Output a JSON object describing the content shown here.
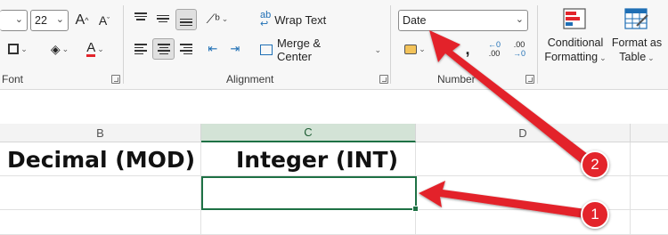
{
  "ribbon": {
    "font": {
      "size_value": "22",
      "grow_label": "A",
      "shrink_label": "A",
      "group_label": "Font"
    },
    "alignment": {
      "wrap_text_label": "Wrap Text",
      "merge_center_label": "Merge & Center",
      "group_label": "Alignment"
    },
    "number": {
      "format_value": "Date",
      "group_label": "Number",
      "increase_decimal_top": "←0",
      "increase_decimal_bottom": ".00",
      "decrease_decimal_top": ".00",
      "decrease_decimal_bottom": "→0"
    },
    "styles": {
      "conditional_line1": "Conditional",
      "conditional_line2": "Formatting",
      "format_table_line1": "Format as",
      "format_table_line2": "Table"
    }
  },
  "sheet": {
    "columns": [
      "B",
      "C",
      "D"
    ],
    "active_column": "C",
    "row1": {
      "b": "Decimal (MOD)",
      "c": "Integer (INT)",
      "d": ""
    }
  },
  "annotations": {
    "badge1": "1",
    "badge2": "2",
    "arrow_color": "#e3242b"
  }
}
